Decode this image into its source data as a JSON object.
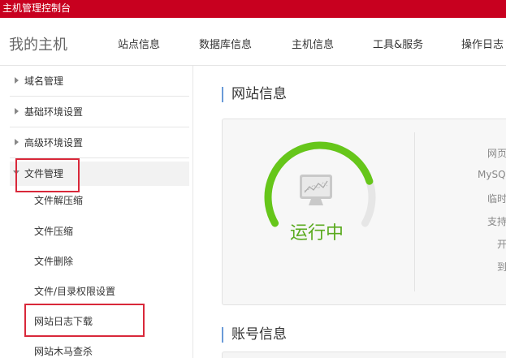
{
  "topbar": {
    "title": "主机管理控制台"
  },
  "nav": {
    "brand": "我的主机",
    "items": [
      {
        "label": "站点信息"
      },
      {
        "label": "数据库信息"
      },
      {
        "label": "主机信息"
      },
      {
        "label": "工具&服务"
      },
      {
        "label": "操作日志"
      }
    ]
  },
  "sidebar": {
    "groups": [
      {
        "label": "域名管理"
      },
      {
        "label": "基础环境设置"
      },
      {
        "label": "高级环境设置"
      },
      {
        "label": "文件管理"
      }
    ],
    "file_items": [
      {
        "label": "文件解压缩"
      },
      {
        "label": "文件压缩"
      },
      {
        "label": "文件删除"
      },
      {
        "label": "文件/目录权限设置"
      },
      {
        "label": "网站日志下载"
      },
      {
        "label": "网站木马查杀"
      }
    ]
  },
  "main": {
    "site_info_title": "网站信息",
    "status": "运行中",
    "status_level": 0.8,
    "info_labels": [
      "网页",
      "MySQL",
      "临时",
      "支持",
      "开",
      "到"
    ],
    "account_title": "账号信息"
  },
  "colors": {
    "topbar": "#c8001f",
    "highlight": "#d9283a",
    "status_green": "#5aaa1e",
    "gauge_track": "#e6e6e6",
    "gauge_fill": "#66c61a"
  }
}
